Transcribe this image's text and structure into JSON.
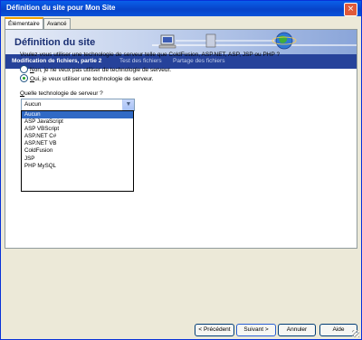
{
  "window": {
    "title": "Définition du site pour Mon Site",
    "close_glyph": "×"
  },
  "tabs": [
    {
      "label": "Élémentaire",
      "active": true
    },
    {
      "label": "Avancé",
      "active": false
    }
  ],
  "header": {
    "title": "Définition du site"
  },
  "steps": [
    {
      "label": "Modification de fichiers, partie 2",
      "current": true
    },
    {
      "label": "Test des fichiers",
      "current": false
    },
    {
      "label": "Partage des fichiers",
      "current": false
    }
  ],
  "question": "Voulez-vous utiliser une technologie de serveur telle que ColdFusion, ASP.NET, ASP, JSP ou PHP ?",
  "radios": [
    {
      "accel": "N",
      "rest": "on, je ne veux pas utiliser de technologie de serveur.",
      "checked": false
    },
    {
      "accel": "O",
      "rest": "ui, je veux utiliser une technologie de serveur.",
      "checked": true
    }
  ],
  "tech_label": {
    "accel": "Q",
    "rest": "uelle technologie de serveur ?"
  },
  "select": {
    "value": "Aucun",
    "options": [
      "Aucun",
      "ASP JavaScript",
      "ASP VBScript",
      "ASP.NET C#",
      "ASP.NET VB",
      "ColdFusion",
      "JSP",
      "PHP MySQL"
    ]
  },
  "buttons": {
    "back": "< Précédent",
    "next": "Suivant >",
    "cancel": "Annuler",
    "help": "Aide"
  }
}
